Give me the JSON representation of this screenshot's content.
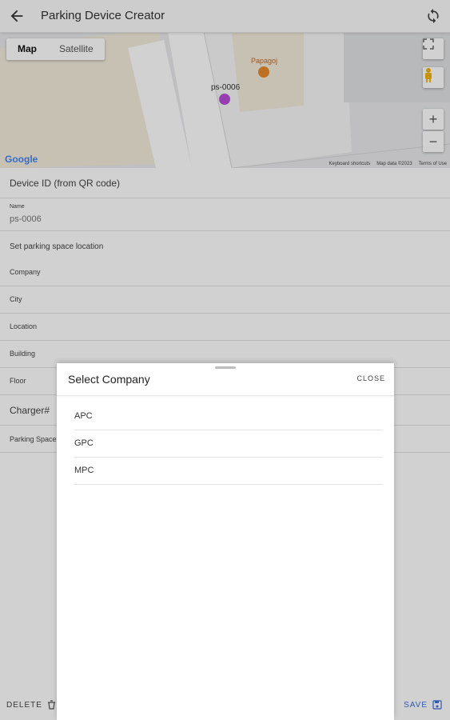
{
  "app": {
    "title": "Parking Device Creator",
    "back_icon": "arrow-left-icon",
    "sync_icon": "sync-icon"
  },
  "map": {
    "tabs": [
      "Map",
      "Satellite"
    ],
    "active_tab": "Map",
    "poi_label": "Papagoj",
    "marker_label": "ps-0006",
    "marker_color": "#b84fd6",
    "google_logo": "Google",
    "attribution": [
      "Keyboard shortcuts",
      "Map data ©2023",
      "Terms of Use"
    ],
    "controls": {
      "fullscreen": "fullscreen-icon",
      "pegman": "pegman-icon",
      "zoom_in": "+",
      "zoom_out": "−"
    }
  },
  "form": {
    "device_id_label": "Device ID (from QR code)",
    "name_label": "Name",
    "name_value": "ps-0006",
    "location_section": "Set parking space location",
    "company_label": "Company",
    "city_label": "City",
    "location_label": "Location",
    "building_label": "Building",
    "floor_label": "Floor",
    "charger_label": "Charger#",
    "parking_space_label": "Parking Space"
  },
  "footer": {
    "delete_label": "DELETE",
    "save_label": "SAVE",
    "accent": "#3b6fd9"
  },
  "sheet": {
    "title": "Select Company",
    "close_label": "CLOSE",
    "options": [
      "APC",
      "GPC",
      "MPC"
    ]
  }
}
